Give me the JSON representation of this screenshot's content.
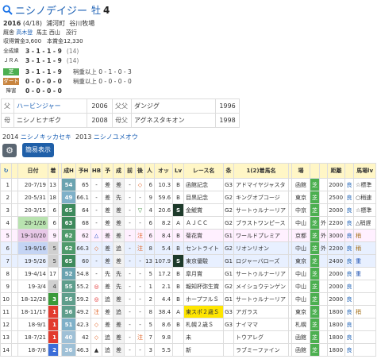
{
  "horse": {
    "name": "ニシノデイジー",
    "sex": "牡",
    "age": "4"
  },
  "info": {
    "birth_year": "2016",
    "birth_date": "(4/18)",
    "birthplace": "浦河町",
    "breeder": "谷川牧場",
    "trainer_label": "厩舎",
    "trainer": "高木登",
    "owner_label": "馬主",
    "owner": "西山　茂行",
    "prize": "収得賞金3,600　本賞金12,330"
  },
  "records": [
    {
      "label": "全成績",
      "vals": "3 - 1 - 1 - 9",
      "total": "(14)",
      "bg": "",
      "sub": ""
    },
    {
      "label": "ＪＲＡ",
      "vals": "3 - 1 - 1 - 9",
      "total": "(14)",
      "bg": "",
      "sub": ""
    },
    {
      "label": "芝",
      "vals": "3 - 1 - 1 - 9",
      "total": "",
      "bg": "#4caf50",
      "sub": "稍重以上 0 - 1 - 0 - 3"
    },
    {
      "label": "ダート",
      "vals": "0 - 0 - 0 - 0",
      "total": "",
      "bg": "#c8843e",
      "sub": "稍重以上 0 - 0 - 0 - 0"
    },
    {
      "label": "障害",
      "vals": "0 - 0 - 0 - 0",
      "total": "",
      "bg": "",
      "sub": ""
    }
  ],
  "pedigree": [
    {
      "l1": "父",
      "n1": "ハービンジャー",
      "y1": "2006",
      "l2": "父父",
      "n2": "ダンジグ",
      "y2": "1996"
    },
    {
      "l1": "母",
      "n1": "ニシノヒナギク",
      "y1": "2008",
      "l2": "母父",
      "n2": "アグネスタキオン",
      "y2": "1998"
    }
  ],
  "siblings": [
    {
      "year": "2014",
      "name": "ニシノキッカセキ"
    },
    {
      "year": "2013",
      "name": "ニシノユメオウ"
    }
  ],
  "buttons": {
    "gear": "⚙",
    "simple": "簡易表示"
  },
  "table": {
    "headers": [
      "↻",
      "",
      "日付",
      "着",
      "",
      "成H",
      "予H",
      "HB",
      "予",
      "成",
      "前",
      "後",
      "人",
      "オッ",
      "Lv",
      "レース名",
      "条",
      "1(2)着馬名",
      "",
      "場",
      "",
      "",
      "距離",
      "",
      "馬場lv"
    ],
    "rows": [
      {
        "n": "1",
        "d": "20-7/19",
        "p": "13",
        "c": "54",
        "ch": "65",
        "hm": "-",
        "hb": "差",
        "yo": "差",
        "se": "-",
        "ma": "◇",
        "us": "-",
        "po": "6",
        "od": "10.3",
        "lv": "B",
        "race": "函館記念",
        "jo": "G3",
        "win": "アドマイヤジャスタ",
        "ba": "函館",
        "su": "芝",
        "dist": "2000",
        "go": "良",
        "bl": "☆標準"
      },
      {
        "n": "2",
        "d": "20-5/31",
        "p": "18",
        "c": "49",
        "ch": "66.1",
        "hm": "-",
        "hb": "差",
        "yo": "先",
        "se": "-",
        "ma": "-",
        "us": "-",
        "po": "9",
        "od": "59.6",
        "lv": "B",
        "race": "目黒記念",
        "jo": "G2",
        "win": "キングオブコージ",
        "ba": "東京",
        "su": "芝",
        "dist": "2500",
        "go": "良",
        "bl": "○稍速"
      },
      {
        "n": "3",
        "d": "20-3/15",
        "p": "6",
        "c": "65",
        "ch": "64",
        "hm": "-",
        "hb": "差",
        "yo": "差",
        "se": "-",
        "ma": "▽",
        "us": "4",
        "po": "4",
        "od": "20.6",
        "lv": "S",
        "race": "金鯱賞",
        "jo": "G2",
        "win": "サートゥルナーリア",
        "ba": "中京",
        "su": "芝",
        "dist": "2000",
        "go": "良",
        "bl": "☆標準"
      },
      {
        "n": "4",
        "d": "20-1/26",
        "p": "6",
        "c": "63",
        "ch": "68",
        "hm": "-",
        "hb": "差",
        "yo": "差",
        "se": "-",
        "ma": "-",
        "us": "-",
        "po": "6",
        "od": "8.2",
        "lv": "A",
        "race": "ＡＪＣＣ",
        "jo": "G2",
        "win": "ブラストワンピース",
        "ba": "中山",
        "su": "芝",
        "sg": "外",
        "dist": "2200",
        "go": "良",
        "bl": "△稍遅"
      },
      {
        "n": "5",
        "d": "19-10/20",
        "p": "9",
        "c": "62",
        "ch": "62",
        "hm": "△",
        "hb": "差",
        "yo": "差",
        "se": "-",
        "ma": "注",
        "us": "2",
        "po": "6",
        "od": "8.4",
        "lv": "B",
        "race": "菊花賞",
        "jo": "G1",
        "win": "ワールドプレミア",
        "ba": "京都",
        "su": "芝",
        "sg": "外",
        "dist": "3000",
        "go": "良",
        "bl": "稍"
      },
      {
        "n": "6",
        "d": "19-9/16",
        "p": "5",
        "c": "62",
        "ch": "66.3",
        "hm": "◇",
        "hb": "差",
        "yo": "追",
        "se": "-",
        "ma": "注",
        "us": "5",
        "po": "8",
        "od": "5.4",
        "lv": "B",
        "race": "セントライト",
        "jo": "G2",
        "win": "リオンリオン",
        "ba": "中山",
        "su": "芝",
        "sg": "外",
        "dist": "2200",
        "go": "良",
        "bl": "稍"
      },
      {
        "n": "7",
        "d": "19-5/26",
        "p": "5",
        "c": "65",
        "ch": "60",
        "hm": "-",
        "hb": "差",
        "yo": "差",
        "se": "-",
        "ma": "-",
        "us": "-",
        "po": "13",
        "od": "107.9",
        "lv": "S",
        "race": "東京優駿",
        "jo": "G1",
        "win": "ロジャーバローズ",
        "ba": "東京",
        "su": "芝",
        "dist": "2400",
        "go": "良",
        "bl": "重"
      },
      {
        "n": "8",
        "d": "19-4/14",
        "p": "17",
        "c": "52",
        "ch": "54.8",
        "hm": "-",
        "hb": "先",
        "yo": "先",
        "se": "-",
        "ma": "-",
        "us": "-",
        "po": "5",
        "od": "17.2",
        "lv": "B",
        "race": "皐月賞",
        "jo": "G1",
        "win": "サートゥルナーリア",
        "ba": "中山",
        "su": "芝",
        "dist": "2000",
        "go": "良",
        "bl": "重"
      },
      {
        "n": "9",
        "d": "19-3/4",
        "p": "4",
        "c": "55",
        "ch": "55.2",
        "hm": "◎",
        "hb": "差",
        "yo": "先",
        "se": "-",
        "ma": "-",
        "us": "-",
        "po": "1",
        "od": "2.1",
        "lv": "B",
        "race": "報知杯弥生賞",
        "jo": "G2",
        "win": "メイショウテンゲン",
        "ba": "中山",
        "su": "芝",
        "dist": "2000",
        "go": "良",
        "bl": ""
      },
      {
        "n": "10",
        "d": "18-12/28",
        "p": "3",
        "c": "56",
        "ch": "59.2",
        "hm": "◎",
        "hb": "追",
        "yo": "差",
        "se": "-",
        "ma": "-",
        "us": "-",
        "po": "2",
        "od": "4.4",
        "lv": "B",
        "race": "ホープフルＳ",
        "jo": "G1",
        "win": "サートゥルナーリア",
        "ba": "中山",
        "su": "芝",
        "dist": "2000",
        "go": "良",
        "bl": ""
      },
      {
        "n": "11",
        "d": "18-11/17",
        "p": "1",
        "c": "56",
        "ch": "49.2",
        "hm": "注",
        "hb": "差",
        "yo": "追",
        "se": "-",
        "ma": "-",
        "us": "-",
        "po": "8",
        "od": "38.4",
        "lv": "A",
        "race": "東スポ２歳Ｓ",
        "jo": "G3",
        "win": "アガラス",
        "ba": "東京",
        "su": "芝",
        "dist": "1800",
        "go": "良",
        "bl": "稍"
      },
      {
        "n": "12",
        "d": "18-9/1",
        "p": "1",
        "c": "51",
        "ch": "42.3",
        "hm": "◇",
        "hb": "差",
        "yo": "差",
        "se": "-",
        "ma": "-",
        "us": "-",
        "po": "5",
        "od": "8.6",
        "lv": "B",
        "race": "札幌２歳Ｓ",
        "jo": "G3",
        "win": "ナイママ",
        "ba": "札幌",
        "su": "芝",
        "dist": "1800",
        "go": "良",
        "bl": ""
      },
      {
        "n": "13",
        "d": "18-7/21",
        "p": "1",
        "c": "40",
        "ch": "42",
        "hm": "◇",
        "hb": "追",
        "yo": "差",
        "se": "-",
        "ma": "注",
        "us": "-",
        "po": "7",
        "od": "9.8",
        "lv": "",
        "race": "未",
        "jo": "",
        "win": "トウアレグ",
        "ba": "函館",
        "su": "芝",
        "dist": "1800",
        "go": "良",
        "bl": ""
      },
      {
        "n": "14",
        "d": "18-7/8",
        "p": "2",
        "c": "36",
        "ch": "46.3",
        "hm": "▲",
        "hb": "追",
        "yo": "差",
        "se": "-",
        "ma": "-",
        "us": "-",
        "po": "3",
        "od": "5.5",
        "lv": "",
        "race": "新",
        "jo": "",
        "win": "ラブミーファイン",
        "ba": "函館",
        "su": "芝",
        "dist": "1800",
        "go": "良",
        "bl": ""
      }
    ]
  }
}
